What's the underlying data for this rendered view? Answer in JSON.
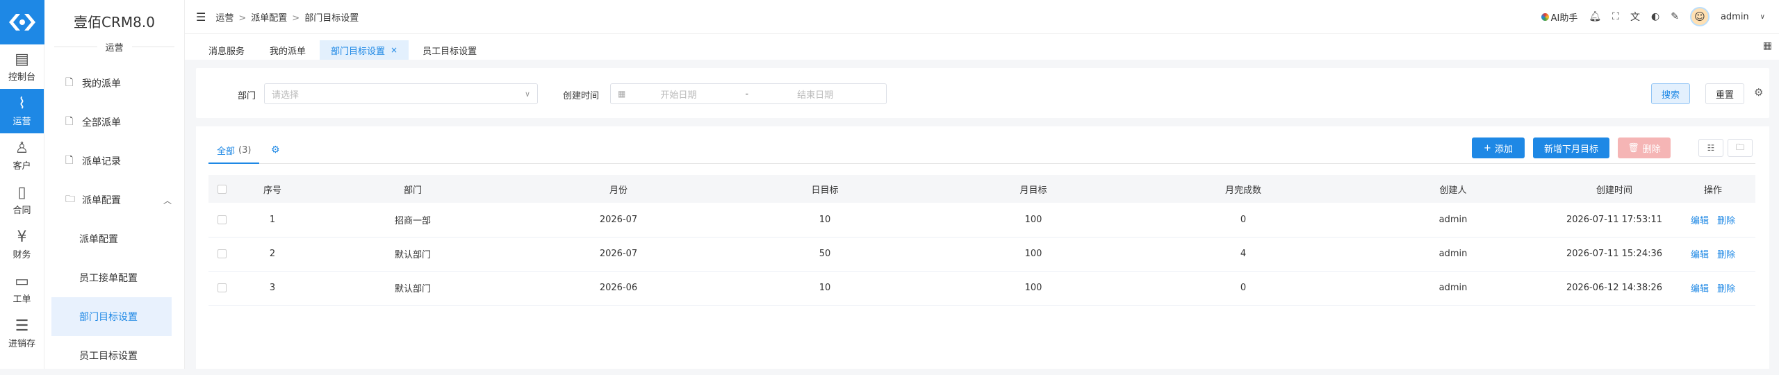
{
  "rail": {
    "items": [
      {
        "label": "控制台",
        "icon": "dashboard-icon"
      },
      {
        "label": "运营",
        "icon": "chart-icon"
      },
      {
        "label": "客户",
        "icon": "user-icon"
      },
      {
        "label": "合同",
        "icon": "contract-icon"
      },
      {
        "label": "财务",
        "icon": "finance-icon"
      },
      {
        "label": "工单",
        "icon": "ticket-icon"
      },
      {
        "label": "进销存",
        "icon": "inventory-icon"
      }
    ]
  },
  "sidebar": {
    "brand": "壹佰CRM8.0",
    "section": "运营",
    "items": [
      {
        "label": "我的派单"
      },
      {
        "label": "全部派单"
      },
      {
        "label": "派单记录"
      },
      {
        "label": "派单配置"
      }
    ],
    "sub_items": [
      {
        "label": "派单配置"
      },
      {
        "label": "员工接单配置"
      },
      {
        "label": "部门目标设置"
      },
      {
        "label": "员工目标设置"
      }
    ]
  },
  "header": {
    "breadcrumb": [
      "运营",
      "派单配置",
      "部门目标设置"
    ],
    "ai_label": "AI助手",
    "user": "admin"
  },
  "tabs": [
    {
      "label": "消息服务"
    },
    {
      "label": "我的派单"
    },
    {
      "label": "部门目标设置"
    },
    {
      "label": "员工目标设置"
    }
  ],
  "filter": {
    "dept_label": "部门",
    "dept_placeholder": "请选择",
    "time_label": "创建时间",
    "start_placeholder": "开始日期",
    "range_sep": "-",
    "end_placeholder": "结束日期",
    "search": "搜索",
    "reset": "重置"
  },
  "list": {
    "tab_label": "全部",
    "tab_count": "(3)",
    "add": "添加",
    "add_next_month": "新增下月目标",
    "delete": "删除",
    "columns": [
      "序号",
      "部门",
      "月份",
      "日目标",
      "月目标",
      "月完成数",
      "创建人",
      "创建时间",
      "操作"
    ],
    "edit": "编辑",
    "remove": "删除",
    "rows": [
      [
        "1",
        "招商一部",
        "2026-07",
        "10",
        "100",
        "0",
        "admin",
        "2026-07-11 17:53:11"
      ],
      [
        "2",
        "默认部门",
        "2026-07",
        "50",
        "100",
        "4",
        "admin",
        "2026-07-11 15:24:36"
      ],
      [
        "3",
        "默认部门",
        "2026-06",
        "10",
        "100",
        "0",
        "admin",
        "2026-06-12 14:38:26"
      ]
    ]
  },
  "colors": {
    "accent": "#1e88e5",
    "danger_disabled": "#f5b5b5"
  }
}
